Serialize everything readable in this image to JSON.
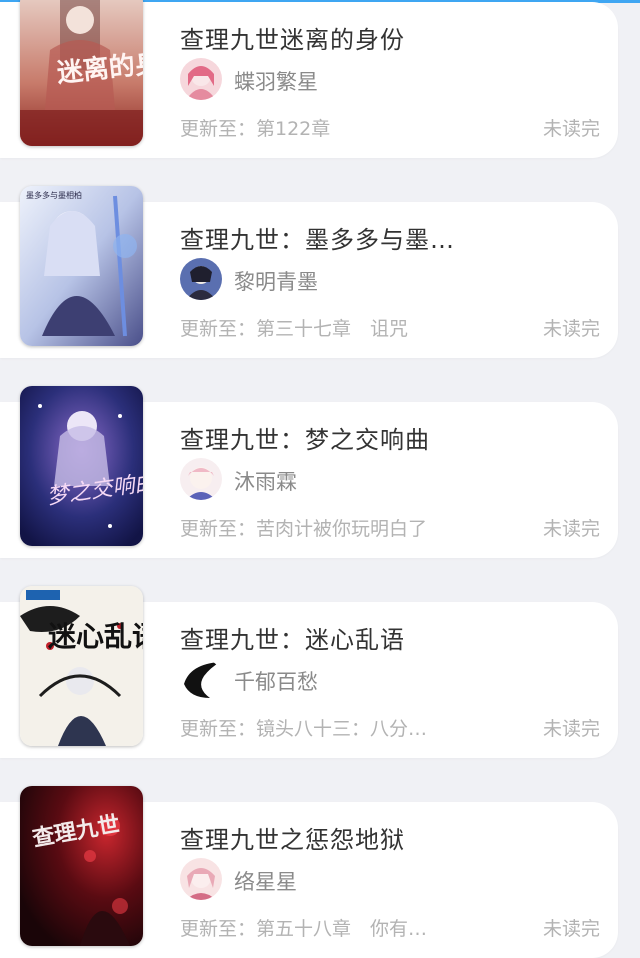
{
  "colors": {
    "background": "#f0f1f5",
    "card": "#ffffff",
    "title_text": "#333333",
    "author_text": "#8a8a8a",
    "meta_text": "#b3b3b3",
    "accent": "#3fa6f2"
  },
  "books": [
    {
      "title": "查理九世迷离的身份",
      "author": "蝶羽繁星",
      "update": "更新至：第122章",
      "status": "未读完",
      "cover_text": "迷离的身份"
    },
    {
      "title": "查理九世：墨多多与墨…",
      "author": "黎明青墨",
      "update": "更新至：第三十七章　诅咒",
      "status": "未读完",
      "cover_text": "墨多多与墨相柏"
    },
    {
      "title": "查理九世：梦之交响曲",
      "author": "沐雨霖",
      "update": "更新至：苦肉计被你玩明白了",
      "status": "未读完",
      "cover_text": "梦之交响曲"
    },
    {
      "title": "查理九世：迷心乱语",
      "author": "千郁百愁",
      "update": "更新至：镜头八十三：八分…",
      "status": "未读完",
      "cover_text": "迷心乱语"
    },
    {
      "title": "查理九世之惩怨地狱",
      "author": "络星星",
      "update": "更新至：第五十八章　你有…",
      "status": "未读完",
      "cover_text": "查理九世"
    }
  ]
}
